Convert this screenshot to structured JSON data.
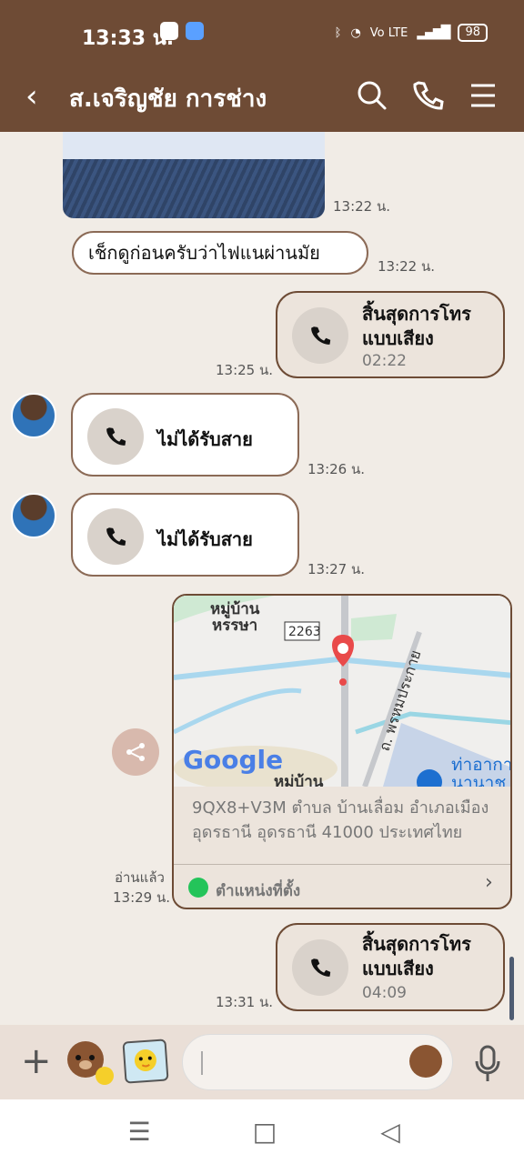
{
  "status_bar": {
    "time": "13:33 น.",
    "battery": "98",
    "network_label": "Vo LTE"
  },
  "header": {
    "title": "ส.เจริญชัย การช่าง",
    "icons": [
      "back-icon",
      "search-icon",
      "phone-icon",
      "menu-icon"
    ]
  },
  "messages": [
    {
      "type": "image",
      "time": "13:22 น."
    },
    {
      "type": "text",
      "text": "เช็กดูก่อนครับว่าไฟแนผ่านมัย",
      "time": "13:22 น."
    },
    {
      "type": "call_out",
      "title": "สิ้นสุดการโทร แบบเสียง",
      "duration": "02:22",
      "time": "13:25 น."
    },
    {
      "type": "missed_call",
      "title": "ไม่ได้รับสาย",
      "time": "13:26 น."
    },
    {
      "type": "missed_call",
      "title": "ไม่ได้รับสาย",
      "time": "13:27 น."
    },
    {
      "type": "location",
      "map_labels": [
        "หมู่บ้าน",
        "หรรษา",
        "2263",
        "ถ. พรหมประกาย",
        "Google",
        "หมู่บ้าน",
        "ท่าอากา",
        "นานาช"
      ],
      "address": "9QX8+V3M ตำบล บ้านเลื่อม อำเภอเมือง อุดรธานี อุดรธานี 41000 ประเทศไทย",
      "link": "ตำแหน่งที่ตั้ง",
      "read_label": "อ่านแล้ว",
      "time": "13:29 น."
    },
    {
      "type": "call_out",
      "title": "สิ้นสุดการโทร แบบเสียง",
      "duration": "04:09",
      "time": "13:31 น."
    }
  ],
  "composer": {
    "placeholder": ""
  },
  "colors": {
    "header": "#6e4b35",
    "chat_bg": "#f1ece6",
    "bubble_border": "#6d4b35",
    "map_pin": "#e94a4a"
  }
}
